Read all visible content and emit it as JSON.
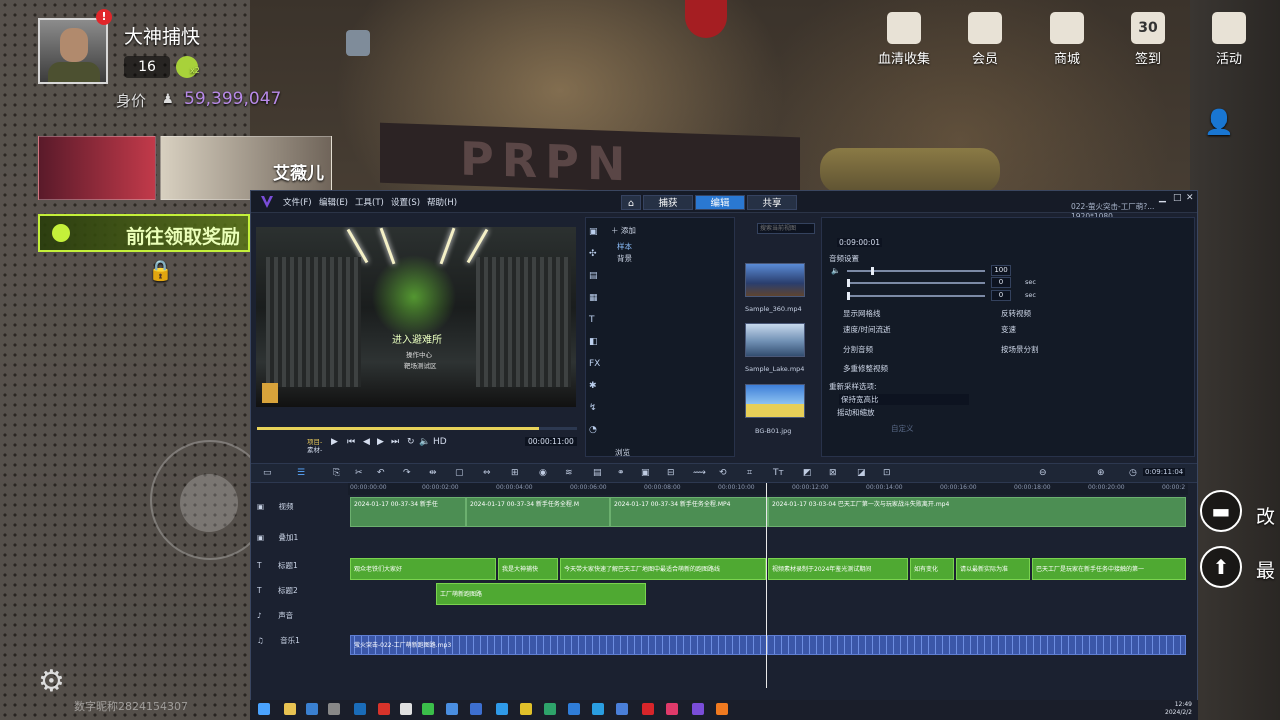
{
  "game": {
    "player_name": "大神捕快",
    "level": "16",
    "notification_badge": "!",
    "skull_count": "x2",
    "worth_label": "身价",
    "worth_value": "59,399,047",
    "character_name": "艾薇儿",
    "reward_button": "前往领取奖励",
    "top_menu": [
      {
        "label": "血清收集",
        "icon": "serum-icon"
      },
      {
        "label": "会员",
        "icon": "member-icon"
      },
      {
        "label": "商城",
        "icon": "shop-icon"
      },
      {
        "label": "签到",
        "icon": "calendar-icon",
        "badge": "30"
      },
      {
        "label": "活动",
        "icon": "gift-icon"
      }
    ],
    "right_buttons": [
      "改",
      "最"
    ],
    "watermark": "数字昵称2824154307"
  },
  "editor": {
    "menus": [
      "文件(F)",
      "编辑(E)",
      "工具(T)",
      "设置(S)",
      "帮助(H)"
    ],
    "tabs": [
      "捕获",
      "编辑",
      "共享"
    ],
    "active_tab": "编辑",
    "window_title": "022-萤火突击-工厂萌?... 1920*1080",
    "preview_text": {
      "main": "进入避难所",
      "line2": "操作中心",
      "line3": "靶场测试区"
    },
    "playback": {
      "project_label": "项目-",
      "clip_label": "素材-",
      "hd": "HD",
      "timecode": "00:00:11:00"
    },
    "library": {
      "add_label": "添加",
      "items": [
        "样本",
        "背景"
      ],
      "browse_label": "浏览",
      "search_placeholder": "搜索当前视图",
      "thumbs": [
        "Sample_360.mp4",
        "Sample_Lake.mp4",
        "BG-B01.jpg"
      ]
    },
    "options": {
      "duration": "0:09:00:01",
      "audio_settings": "音频设置",
      "volume": "100",
      "fade_in": "0",
      "fade_out": "0",
      "unit": "sec",
      "checks": [
        "显示网格线",
        "反转视频",
        "速度/时间流逝",
        "变速",
        "分割音频",
        "按场景分割",
        "多重修整视频"
      ],
      "resample_label": "重新采样选项:",
      "resample_value": "保持宽高比",
      "pan_zoom": "摇动和缩放",
      "custom": "自定义"
    },
    "timeline": {
      "total_time": "0:09:11:04",
      "ruler": [
        "00:00:00:00",
        "00:00:02:00",
        "00:00:04:00",
        "00:00:06:00",
        "00:00:08:00",
        "00:00:10:00",
        "00:00:12:00",
        "00:00:14:00",
        "00:00:16:00",
        "00:00:18:00",
        "00:00:20:00",
        "00:00:2"
      ],
      "tracks": [
        "视频",
        "叠加1",
        "标题1",
        "标题2",
        "声音",
        "音乐1"
      ],
      "video_clips": [
        "2024-01-17 00-37-34 新手任",
        "2024-01-17 00-37-34 新手任务全程.M",
        "2024-01-17 00-37-34 新手任务全程.MP4",
        "2024-01-17 03-03-04 巴天工厂第一次与玩家战斗失败离开.mp4"
      ],
      "title1_clips": [
        "观众老铁们大家好",
        "我是大神捕快",
        "今天带大家快速了解巴天工厂地图中最适合萌新的跑图路线",
        "视频素材录制于2024年鉴光测试期间",
        "如有变化",
        "请以最新实际为准",
        "巴天工厂是玩家在新手任务中接触的第一"
      ],
      "title2_clips": [
        "工厂萌新跑图路"
      ],
      "music_clip": "萤火突击-022-工厂萌新跑图路.mp3"
    },
    "taskbar_clock": {
      "time": "12:49",
      "date": "2024/2/2"
    }
  }
}
